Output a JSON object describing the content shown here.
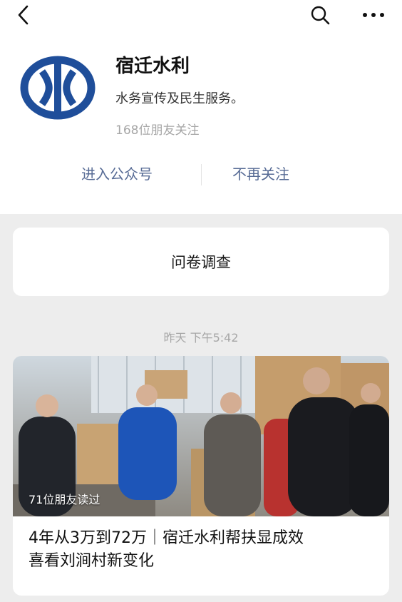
{
  "account": {
    "name": "宿迁水利",
    "description": "水务宣传及民生服务。",
    "followers": "168位朋友关注"
  },
  "actions": {
    "enter_label": "进入公众号",
    "unfollow_label": "不再关注"
  },
  "survey": {
    "label": "问卷调查"
  },
  "feed": {
    "timestamp": "昨天 下午5:42"
  },
  "article": {
    "read_count": "71位朋友读过",
    "title_line1": "4年从3万到72万｜宿迁水利帮扶显成效",
    "title_line2": "喜看刘涧村新变化"
  },
  "icons": {
    "back": "back-arrow-icon",
    "search": "search-icon",
    "more": "more-icon"
  },
  "colors": {
    "link": "#576b95",
    "logo_blue": "#1f4e9a",
    "background": "#ededed"
  }
}
